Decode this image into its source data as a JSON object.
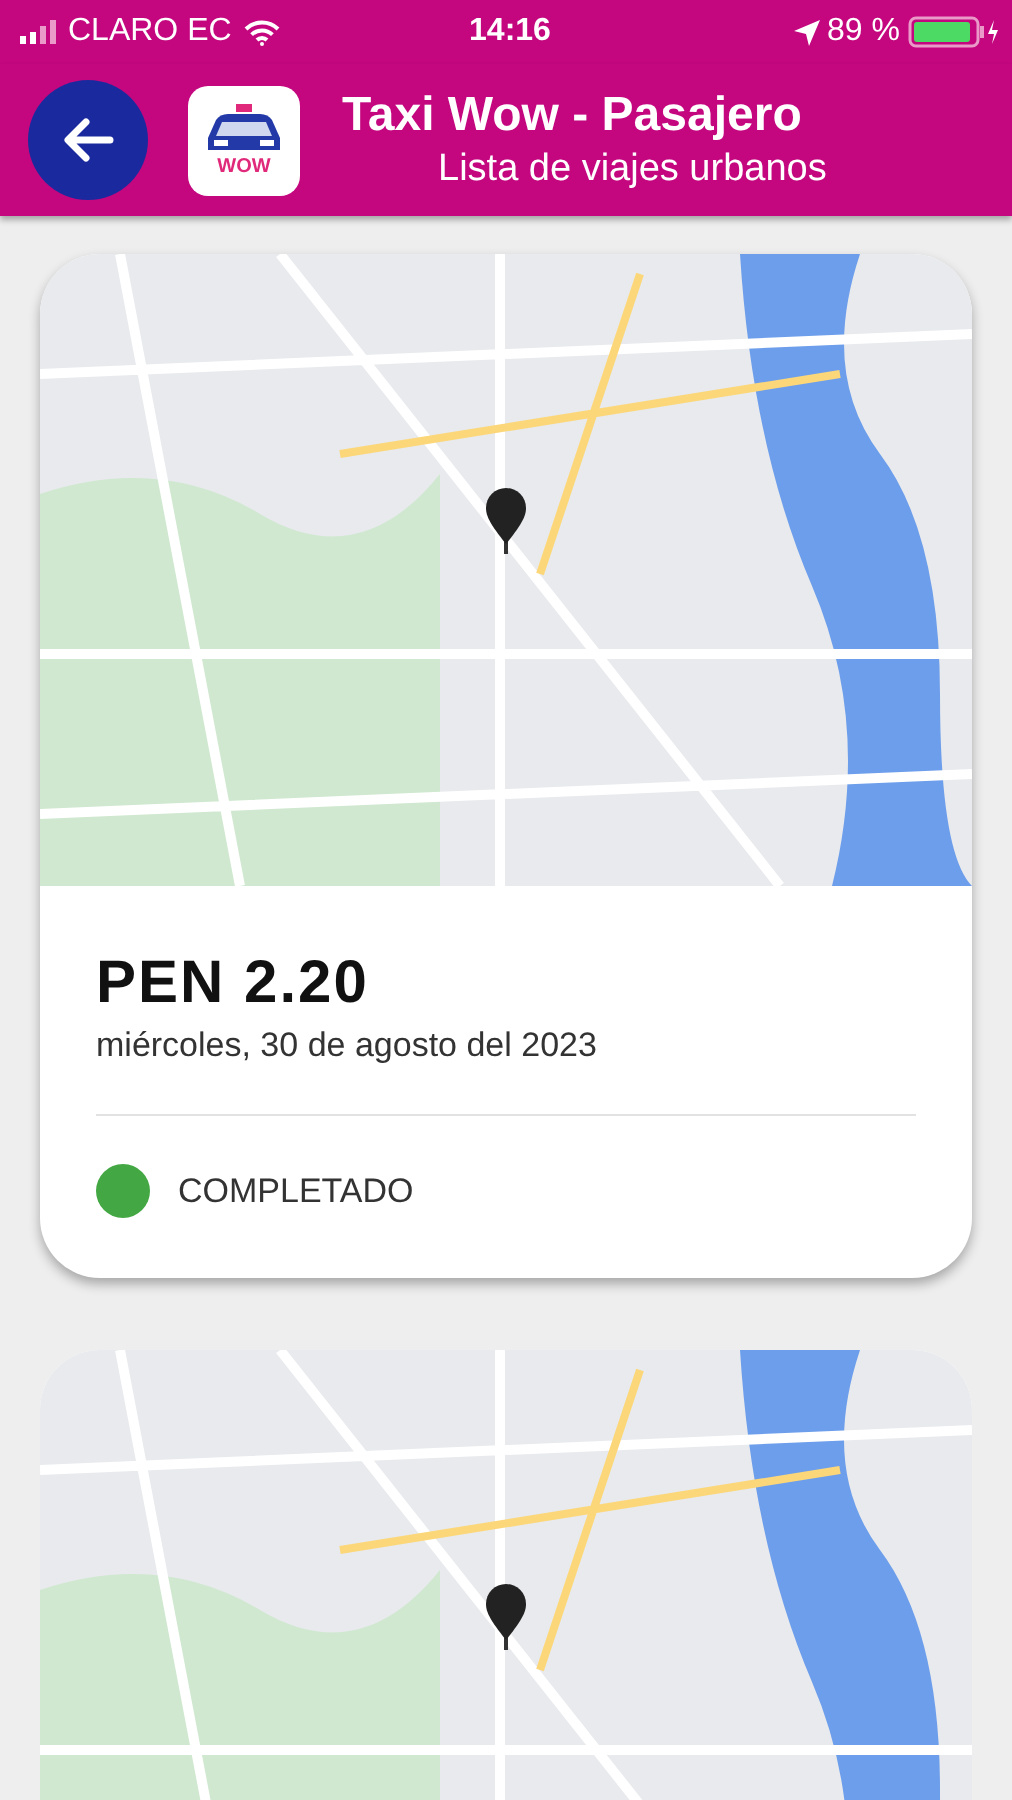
{
  "status_bar": {
    "carrier": "CLARO EC",
    "time": "14:16",
    "battery": "89 %"
  },
  "header": {
    "title": "Taxi Wow - Pasajero",
    "subtitle": "Lista de viajes urbanos",
    "logo_text": "WOW"
  },
  "trips": [
    {
      "kind": "full",
      "price": "PEN 2.20",
      "date": "miércoles, 30 de agosto del 2023",
      "status": "COMPLETADO",
      "color": "#43a843"
    },
    {
      "kind": "map_only"
    }
  ]
}
